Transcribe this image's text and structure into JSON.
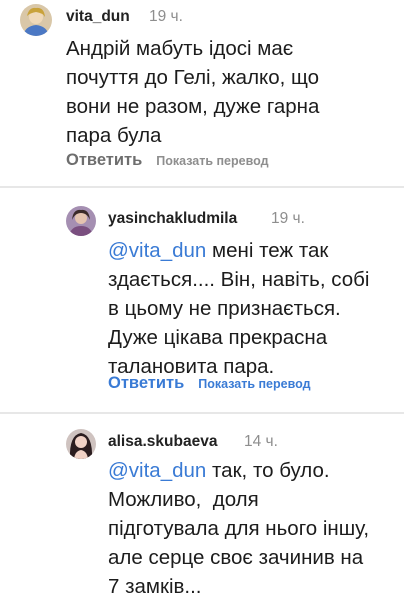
{
  "colors": {
    "mention": "#3a7bd5",
    "reply_gray": "#6e6e6e",
    "reply_blue": "#3a7bd5",
    "muted": "#8e8e8e"
  },
  "comments": [
    {
      "username": "vita_dun",
      "time": "19 ч.",
      "mention": "",
      "lines": [
        "Андрій мабуть ідосі має",
        "почуття до Гелі, жалко, що",
        "вони не разом, дуже гарна",
        "пара була"
      ],
      "reply_label": "Ответить",
      "translate_label": "Показать перевод"
    },
    {
      "username": "yasinchakludmila",
      "time": "19 ч.",
      "mention": "@vita_dun",
      "lines": [
        " мені теж так",
        "здається.... Він, навіть, собі",
        "в цьому не признається.",
        "Дуже цікава прекрасна",
        "талановита пара."
      ],
      "reply_label": "Ответить",
      "translate_label": "Показать перевод"
    },
    {
      "username": "alisa.skubaeva",
      "time": "14 ч.",
      "mention": "@vita_dun",
      "lines": [
        " так, то було.",
        "Можливо,  доля",
        "підготувала для нього іншу,",
        "але серце своє зачинив на",
        "7 замків..."
      ]
    }
  ]
}
